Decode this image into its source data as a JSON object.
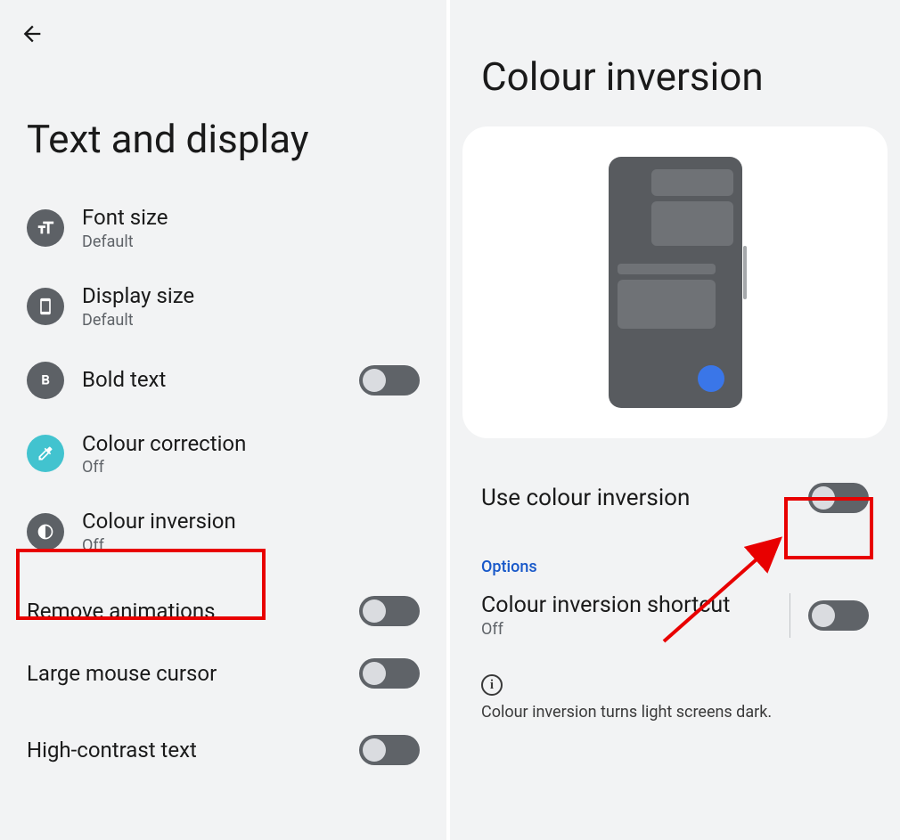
{
  "left": {
    "title": "Text and display",
    "items": [
      {
        "label": "Font size",
        "sub": "Default"
      },
      {
        "label": "Display size",
        "sub": "Default"
      },
      {
        "label": "Bold text"
      },
      {
        "label": "Colour correction",
        "sub": "Off"
      },
      {
        "label": "Colour inversion",
        "sub": "Off"
      },
      {
        "label": "Remove animations"
      },
      {
        "label": "Large mouse cursor"
      },
      {
        "label": "High-contrast text"
      }
    ]
  },
  "right": {
    "title": "Colour inversion",
    "use_label": "Use colour inversion",
    "options_header": "Options",
    "shortcut_label": "Colour inversion shortcut",
    "shortcut_sub": "Off",
    "info_text": "Colour inversion turns light screens dark."
  }
}
